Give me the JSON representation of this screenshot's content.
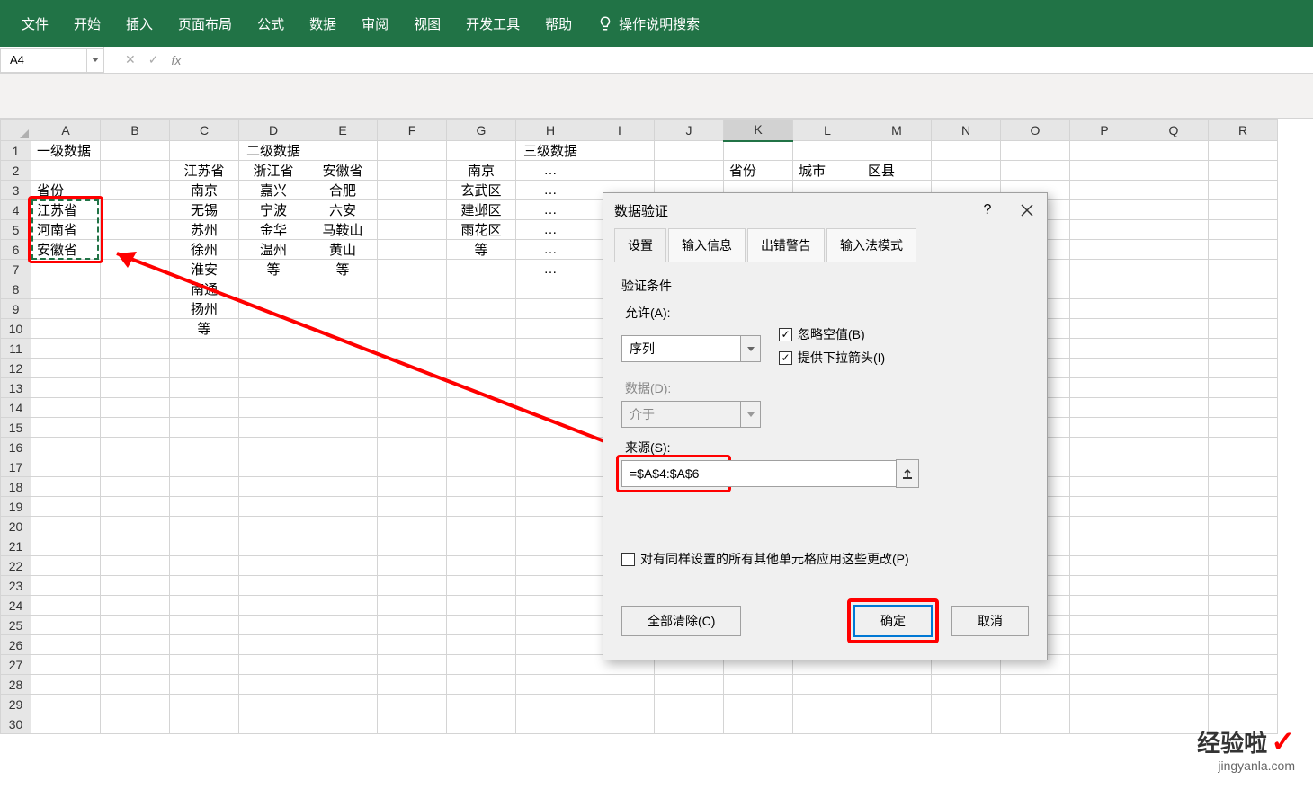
{
  "ribbon": {
    "items": [
      "文件",
      "开始",
      "插入",
      "页面布局",
      "公式",
      "数据",
      "审阅",
      "视图",
      "开发工具",
      "帮助"
    ],
    "tellme": "操作说明搜索"
  },
  "namebox": "A4",
  "fx_buttons": {
    "cancel": "✕",
    "confirm": "✓",
    "fx": "fx"
  },
  "columns": [
    "A",
    "B",
    "C",
    "D",
    "E",
    "F",
    "G",
    "H",
    "I",
    "J",
    "K",
    "L",
    "M",
    "N",
    "O",
    "P",
    "Q",
    "R"
  ],
  "rows_count": 30,
  "cells": {
    "A1": "一级数据",
    "D1": "二级数据",
    "H1": "三级数据",
    "C2": "江苏省",
    "D2": "浙江省",
    "E2": "安徽省",
    "G2": "南京",
    "H2": "…",
    "K2": "省份",
    "L2": "城市",
    "M2": "区县",
    "A3": "省份",
    "C3": "南京",
    "D3": "嘉兴",
    "E3": "合肥",
    "G3": "玄武区",
    "H3": "…",
    "A4": "江苏省",
    "C4": "无锡",
    "D4": "宁波",
    "E4": "六安",
    "G4": "建邺区",
    "H4": "…",
    "A5": "河南省",
    "C5": "苏州",
    "D5": "金华",
    "E5": "马鞍山",
    "G5": "雨花区",
    "H5": "…",
    "A6": "安徽省",
    "C6": "徐州",
    "D6": "温州",
    "E6": "黄山",
    "G6": "等",
    "H6": "…",
    "C7": "淮安",
    "D7": "等",
    "E7": "等",
    "H7": "…",
    "C8": "南通",
    "C9": "扬州",
    "C10": "等"
  },
  "dialog": {
    "title": "数据验证",
    "help": "?",
    "tabs": [
      "设置",
      "输入信息",
      "出错警告",
      "输入法模式"
    ],
    "validation_label": "验证条件",
    "allow_label": "允许(A):",
    "allow_value": "序列",
    "ignore_blank": "忽略空值(B)",
    "dropdown_arrow": "提供下拉箭头(I)",
    "data_label": "数据(D):",
    "data_value": "介于",
    "source_label": "来源(S):",
    "source_value": "=$A$4:$A$6",
    "apply_all": "对有同样设置的所有其他单元格应用这些更改(P)",
    "clear_all": "全部清除(C)",
    "ok": "确定",
    "cancel": "取消"
  },
  "watermark": {
    "text": "经验啦",
    "url": "jingyanla.com"
  }
}
